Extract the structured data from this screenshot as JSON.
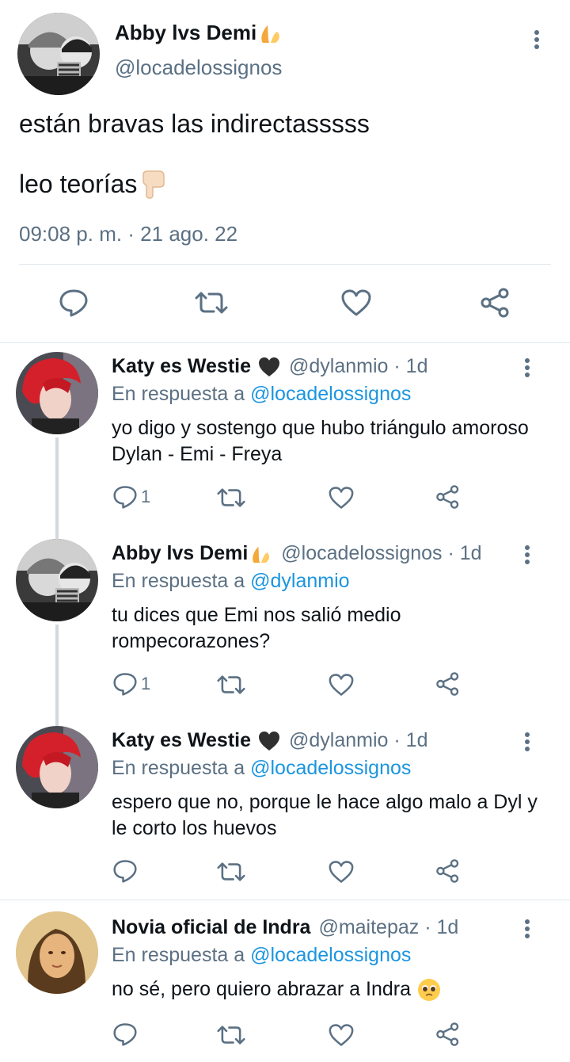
{
  "main_tweet": {
    "display_name": "Abby lvs Demi",
    "handle": "@locadelossignos",
    "text_line_1": "están bravas las indirectasssss",
    "text_line_2": "leo teorías",
    "timestamp": "09:08 p. m. · 21 ago. 22",
    "name_emoji": "praying-hands-icon",
    "pointing_emoji": "pointing-down-icon"
  },
  "replies": [
    {
      "display_name": "Katy es Westie",
      "name_icon": "black-heart-icon",
      "handle_time": "@dylanmio · 1d",
      "replying_prefix": "En respuesta a",
      "replying_to": "@locadelossignos",
      "text": "yo digo y sostengo que hubo triángulo amoroso Dylan - Emi - Freya",
      "reply_count": "1"
    },
    {
      "display_name": "Abby lvs Demi",
      "name_icon": "praying-hands-icon",
      "handle_time": "@locadelossignos · 1d",
      "replying_prefix": "En respuesta a",
      "replying_to": "@dylanmio",
      "text": "tu dices que Emi nos salió medio rompecorazones?",
      "reply_count": "1"
    },
    {
      "display_name": "Katy es Westie",
      "name_icon": "black-heart-icon",
      "handle_time": "@dylanmio · 1d",
      "replying_prefix": "En respuesta a",
      "replying_to": "@locadelossignos",
      "text": "espero que no, porque le hace algo malo a Dyl y le corto los huevos",
      "reply_count": ""
    },
    {
      "display_name": "Novia oficial de Indra",
      "name_icon": "",
      "handle_time": "@maitepaz · 1d",
      "replying_prefix": "En respuesta a",
      "replying_to": "@locadelossignos",
      "text": "no sé, pero quiero abrazar a Indra",
      "text_emoji": "pleading-face-icon",
      "reply_count": ""
    }
  ],
  "colors": {
    "text": "#0f1419",
    "secondary": "#5b7083",
    "link": "#1b95e0",
    "divider": "#e1e8ed"
  }
}
